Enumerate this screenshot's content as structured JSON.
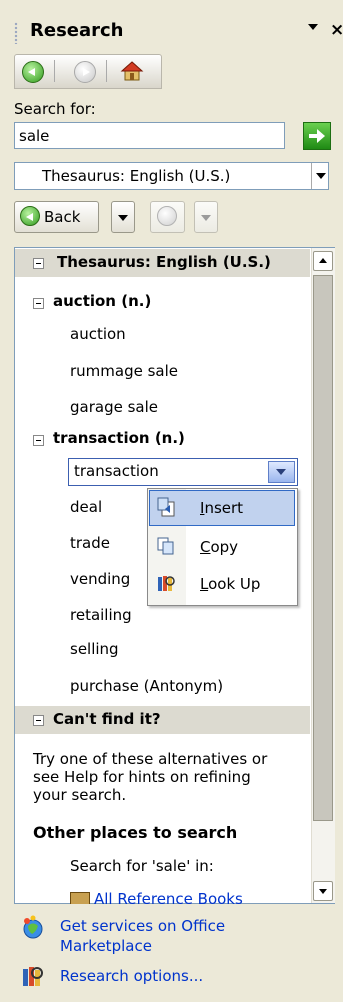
{
  "panel": {
    "title": "Research",
    "search_label": "Search for:",
    "search_value": "sale",
    "source": "Thesaurus: English (U.S.)",
    "back_label": "Back"
  },
  "results": {
    "section_title": "Thesaurus: English (U.S.)",
    "groups": [
      {
        "heading": "auction (n.)",
        "items": [
          "auction",
          "rummage sale",
          "garage sale"
        ]
      },
      {
        "heading": "transaction (n.)",
        "combo": "transaction",
        "items": [
          "deal",
          "trade",
          "vending",
          "retailing",
          "selling",
          "purchase (Antonym)"
        ]
      }
    ],
    "cant_find_title": "Can't find it?",
    "cant_find_text": [
      "Try one of these alternatives or",
      "see Help for hints on refining",
      "your search."
    ],
    "other_places": "Other places to search",
    "search_for_in": "Search for 'sale' in:",
    "all_ref_books": "All Reference Books"
  },
  "context_menu": {
    "items": [
      {
        "label": "Insert",
        "accel": "I",
        "rest": "nsert"
      },
      {
        "label": "Copy",
        "accel": "C",
        "rest": "opy"
      },
      {
        "label": "Look Up",
        "accel": "L",
        "rest": "ook Up"
      }
    ]
  },
  "footer": {
    "marketplace_line1": "Get services on Office",
    "marketplace_line2": "Marketplace",
    "options": "Research options..."
  },
  "colors": {
    "panel_bg": "#ece9d8",
    "header_bg": "#dcdad0",
    "link": "#0033cc",
    "highlight": "#c1d2ee"
  },
  "icons": [
    "back-arrow-icon",
    "forward-arrow-icon",
    "home-icon",
    "go-arrow-icon",
    "insert-icon",
    "copy-icon",
    "lookup-icon",
    "marketplace-icon",
    "research-options-icon"
  ]
}
